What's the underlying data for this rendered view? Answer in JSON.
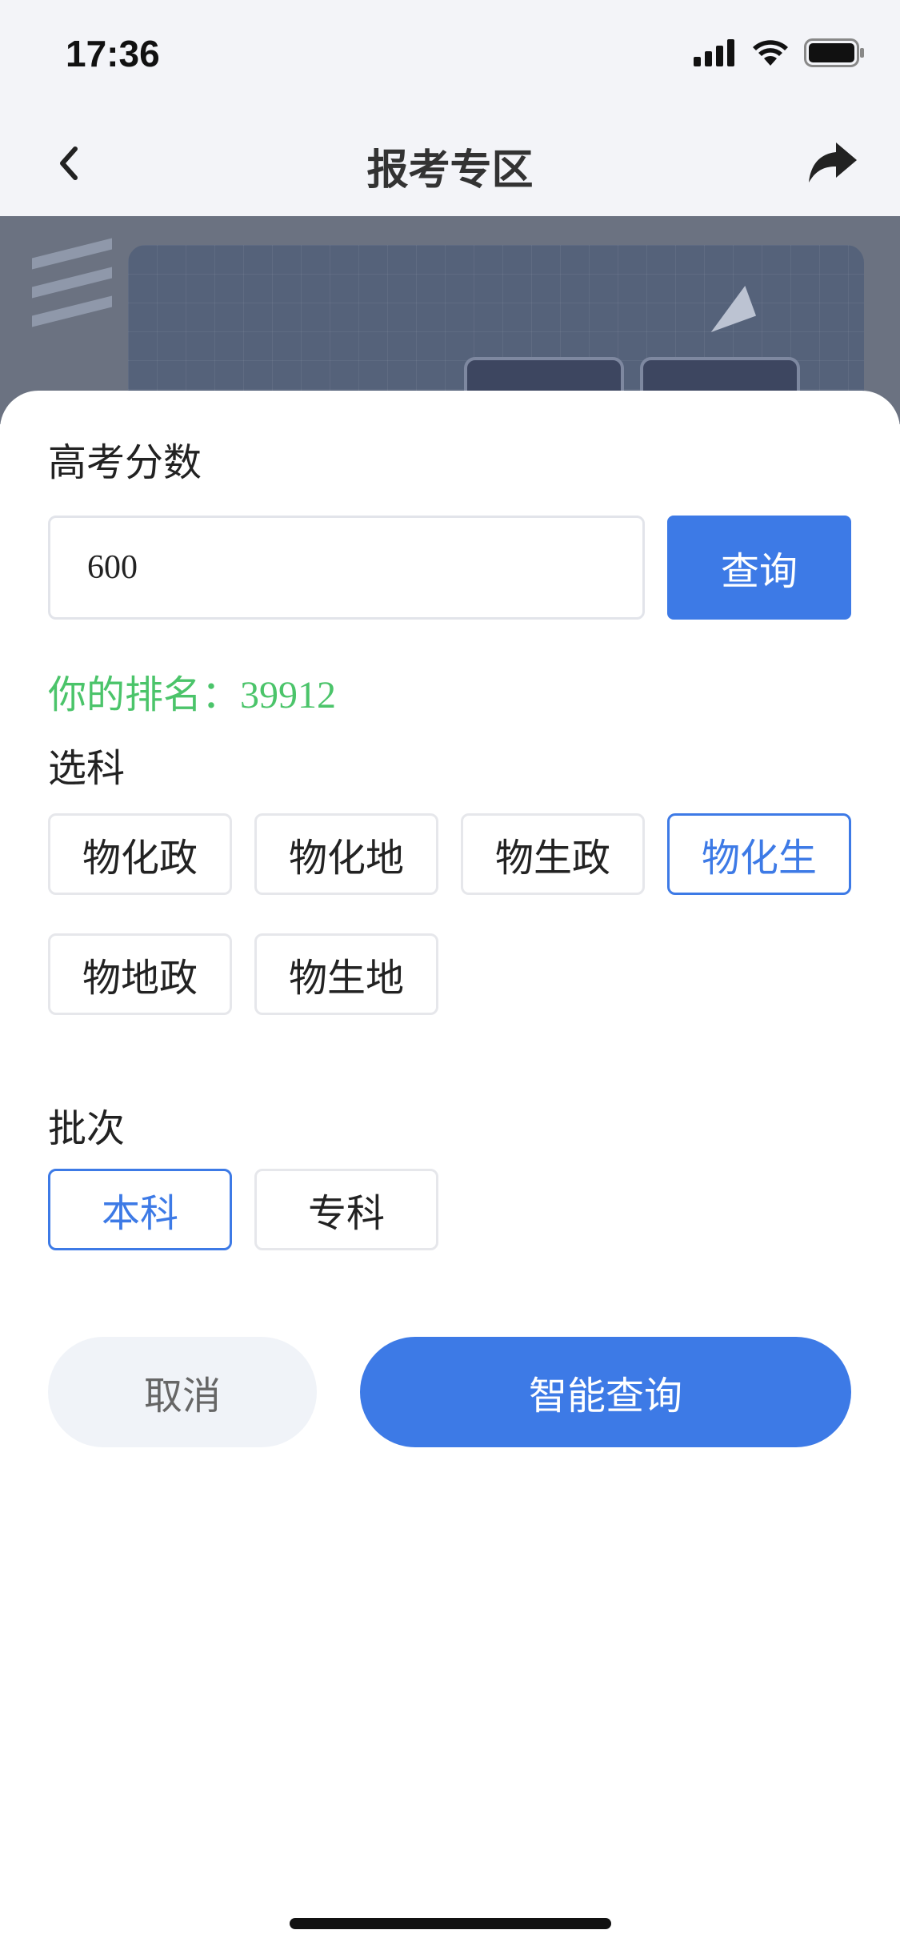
{
  "status_bar": {
    "time": "17:36"
  },
  "nav": {
    "title": "报考专区"
  },
  "form": {
    "score_label": "高考分数",
    "score_value": "600",
    "query_button": "查询",
    "rank_prefix": "你的排名：",
    "rank_value": "39912",
    "subjects_label": "选科",
    "subjects": [
      {
        "label": "物化政",
        "selected": false
      },
      {
        "label": "物化地",
        "selected": false
      },
      {
        "label": "物生政",
        "selected": false
      },
      {
        "label": "物化生",
        "selected": true
      },
      {
        "label": "物地政",
        "selected": false
      },
      {
        "label": "物生地",
        "selected": false
      }
    ],
    "batch_label": "批次",
    "batches": [
      {
        "label": "本科",
        "selected": true
      },
      {
        "label": "专科",
        "selected": false
      }
    ],
    "cancel_button": "取消",
    "smart_query_button": "智能查询"
  },
  "colors": {
    "accent": "#3d7ae6",
    "rank_text": "#4bc46a",
    "cancel_bg": "#f0f3f8"
  }
}
